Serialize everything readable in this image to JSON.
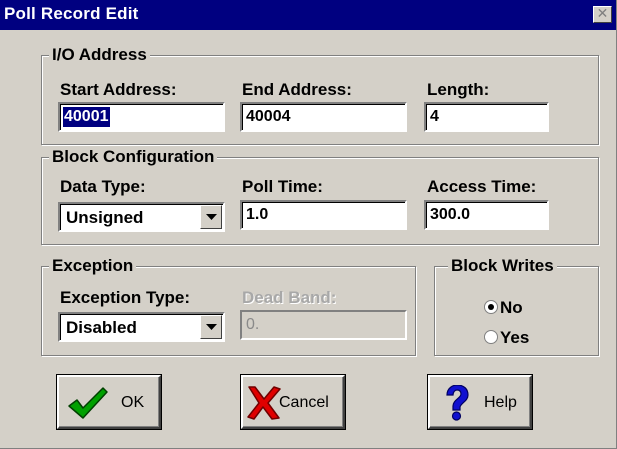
{
  "window": {
    "title": "Poll Record Edit"
  },
  "io_address": {
    "legend": "I/O Address",
    "start_label": "Start Address:",
    "start_value": "40001",
    "end_label": "End Address:",
    "end_value": "40004",
    "length_label": "Length:",
    "length_value": "4"
  },
  "block_config": {
    "legend": "Block Configuration",
    "data_type_label": "Data Type:",
    "data_type_value": "Unsigned",
    "poll_time_label": "Poll Time:",
    "poll_time_value": "1.0",
    "access_time_label": "Access Time:",
    "access_time_value": "300.0"
  },
  "exception": {
    "legend": "Exception",
    "type_label": "Exception Type:",
    "type_value": "Disabled",
    "dead_band_label": "Dead Band:",
    "dead_band_value": "0."
  },
  "block_writes": {
    "legend": "Block Writes",
    "options": [
      "No",
      "Yes"
    ],
    "selected": "No"
  },
  "buttons": {
    "ok": "OK",
    "cancel": "Cancel",
    "help": "Help"
  },
  "icons": {
    "ok": "checkmark-icon",
    "cancel": "red-x-icon",
    "help": "question-mark-icon",
    "dropdown": "chevron-down-icon"
  },
  "colors": {
    "title_bar": "#000080",
    "dialog_bg": "#d4d0c8",
    "selection": "#000080",
    "ok_green": "#00a000",
    "cancel_red": "#e00000",
    "help_blue": "#0000c0"
  }
}
